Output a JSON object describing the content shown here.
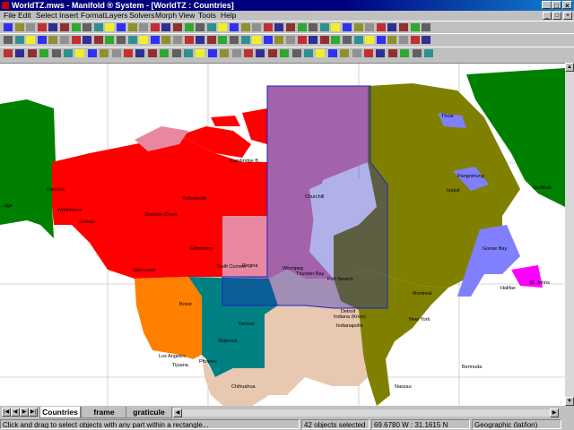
{
  "window": {
    "title": "WorldTZ.mws - Manifold ® System - [WorldTZ : Countries]",
    "controls": [
      "_",
      "□",
      "×"
    ]
  },
  "menu": [
    "File",
    "Edit",
    "Select",
    "Insert",
    "Format",
    "Layers",
    "Solvers",
    "Morph",
    "View",
    "Tools",
    "Help"
  ],
  "mdi_controls": [
    "_",
    "□",
    "×"
  ],
  "map": {
    "colors": {
      "canada": "#ff0000",
      "canada_pink": "#e888a0",
      "canada_olive": "#808000",
      "usa_olive": "#808000",
      "usa_orange": "#ff8000",
      "usa_teal": "#008080",
      "usa_tan": "#e8c8b0",
      "alaska": "#008000",
      "greenland": "#008000",
      "lavender": "#8080ff",
      "magenta": "#ff00ff",
      "selection": "#2020c0"
    },
    "labels": {
      "dawson": "Dawson",
      "whitehorse": "Whitehorse",
      "juneau": "Juneau",
      "dawson_creek": "Dawson Creek",
      "yellowknife": "Yellowknife",
      "cambridge_bay": "Cambridge B...",
      "edmonton": "Edmonton",
      "swift_current": "Swift Current",
      "regina": "Regina",
      "vancouver": "Vancouver",
      "boise": "Boise",
      "denver": "Denver",
      "shiprock": "Shiprock",
      "phoenix": "Phoenix",
      "los_angeles": "Los Angeles",
      "tijuana": "Tijuana",
      "chihuahua": "Chihuahua",
      "churchill": "Churchill",
      "winnipeg": "Winnipeg",
      "thunder_bay": "Thunder Bay",
      "fort_severn": "Fort Severn",
      "montreal": "Montreal",
      "new_york": "New York",
      "detroit": "Detroit",
      "indianapolis": "Indianapolis",
      "indiana_knox": "Indiana (Knox)",
      "iqaluit": "Iqaluit",
      "pangnirtung": "Pangnirtung",
      "goose_bay": "Goose Bay",
      "st_johns": "St. Johns",
      "halifax": "Halifax",
      "godthab": "Godthab",
      "bermuda": "Bermuda",
      "nassau": "Nassau",
      "thule": "Thule",
      "anchorage": "...age"
    }
  },
  "tabs": [
    "Countries",
    "frame",
    "graticule"
  ],
  "status": {
    "hint": "Click and drag to select objects with any part within a rectangle...",
    "selection": "42 objects selected",
    "coords": "69.6780 W : 31.1615 N",
    "projection": "Geographic (lat/lon)"
  }
}
